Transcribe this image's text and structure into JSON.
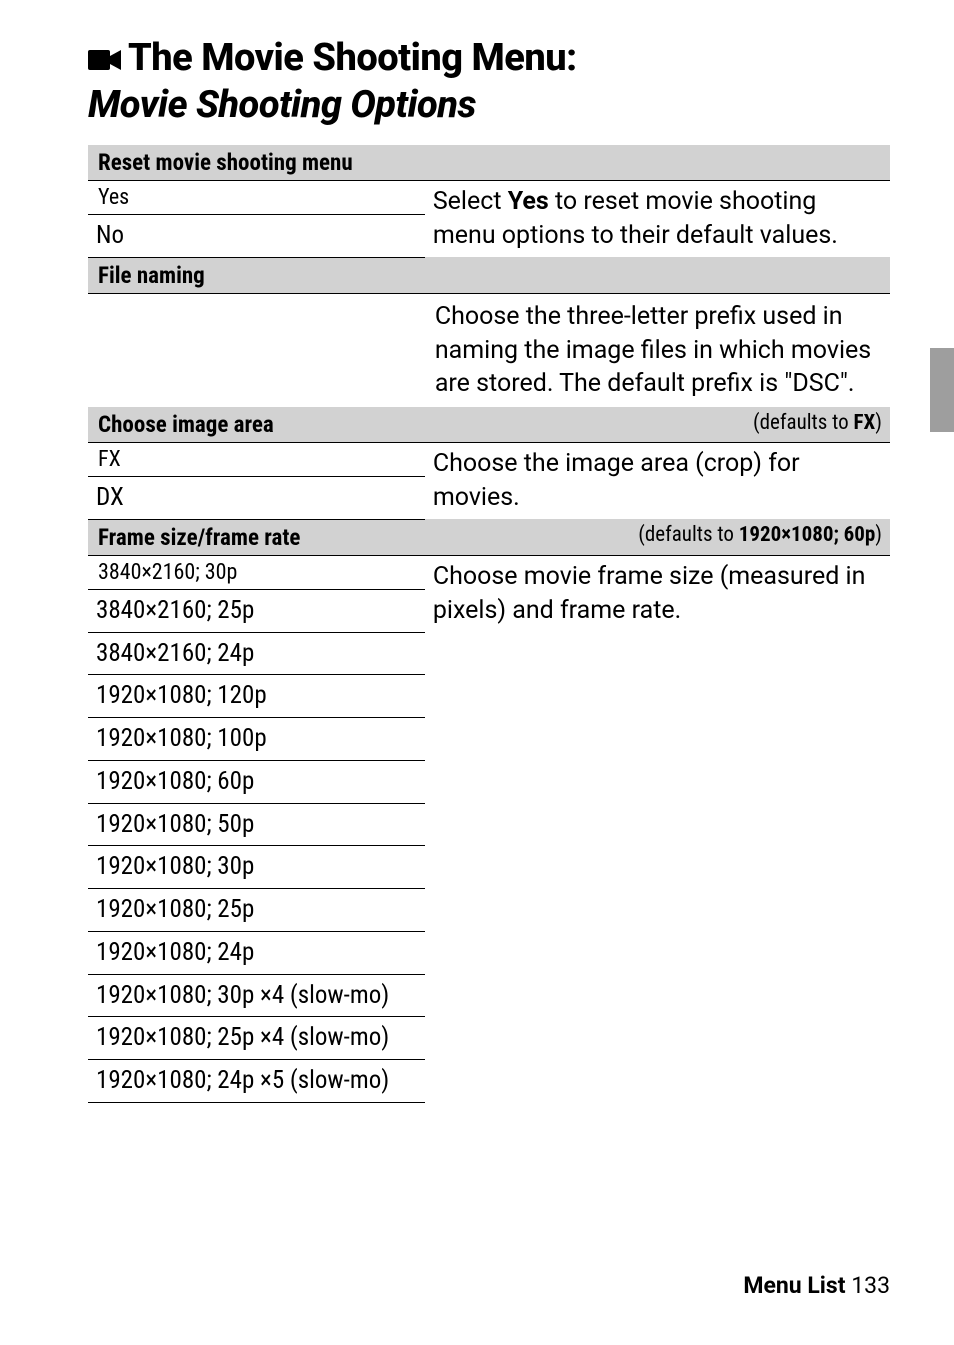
{
  "title": {
    "line1": "The Movie Shooting Menu:",
    "line2": "Movie Shooting Options"
  },
  "sections": [
    {
      "header": "Reset movie shooting menu",
      "header_right": "",
      "desc": "Select Yes to reset movie shooting menu options to their default values.",
      "desc_prefix": "Select ",
      "desc_bold": "Yes",
      "desc_suffix": " to reset movie shooting menu options to their default values.",
      "options": [
        "Yes",
        "No"
      ]
    },
    {
      "header": "File naming",
      "header_right": "",
      "desc": "Choose the three-letter prefix used in naming the image files in which movies are stored. The default prefix is \"DSC\".",
      "options": []
    },
    {
      "header": "Choose image area",
      "header_right_prefix": "(defaults to ",
      "header_right_bold": "FX",
      "header_right_suffix": ")",
      "desc": "Choose the image area (crop) for movies.",
      "options": [
        "FX",
        "DX"
      ]
    },
    {
      "header": "Frame size/frame rate",
      "header_right_prefix": "(defaults to ",
      "header_right_bold": "1920×1080; 60p",
      "header_right_suffix": ")",
      "desc": "Choose movie frame size (measured in pixels) and frame rate.",
      "options": [
        "3840×2160; 30p",
        "3840×2160; 25p",
        "3840×2160; 24p",
        "1920×1080; 120p",
        "1920×1080; 100p",
        "1920×1080; 60p",
        "1920×1080; 50p",
        "1920×1080; 30p",
        "1920×1080; 25p",
        "1920×1080; 24p",
        "1920×1080; 30p ×4 (slow-mo)",
        "1920×1080; 25p ×4 (slow-mo)",
        "1920×1080; 24p ×5 (slow-mo)"
      ]
    }
  ],
  "footer": {
    "label": "Menu List",
    "page": "133"
  }
}
